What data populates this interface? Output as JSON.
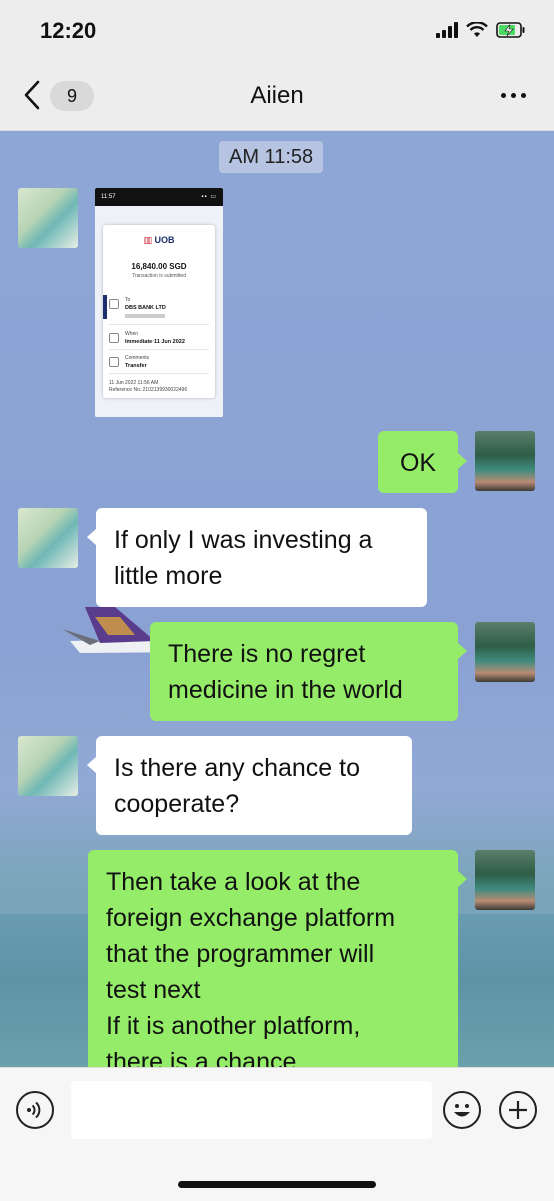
{
  "status_bar": {
    "time": "12:20"
  },
  "nav": {
    "badge": "9",
    "title": "Aiien"
  },
  "chat": {
    "timestamp": "AM 11:58",
    "receipt": {
      "phone_time": "11:57",
      "bank": "UOB",
      "amount": "16,840.00 SGD",
      "status": "Transaction is submitted",
      "to_label": "To",
      "to_value": "DBS BANK LTD",
      "when_label": "When",
      "when_value": "Immediate·11 Jun 2022",
      "comments_label": "Comments",
      "comments_value": "Transfer",
      "footer_time": "11 Jun 2022 11:56 AM",
      "reference": "Reference No.:21021399300224​96"
    },
    "messages": [
      {
        "from": "me",
        "lines": [
          "OK"
        ]
      },
      {
        "from": "contact",
        "lines": [
          "If only I was investing a",
          "little more"
        ]
      },
      {
        "from": "me",
        "lines": [
          "There is no regret",
          "medicine in the world"
        ]
      },
      {
        "from": "contact",
        "lines": [
          "Is there any chance to",
          "cooperate?"
        ]
      },
      {
        "from": "me",
        "lines": [
          "Then take a look at the",
          "foreign exchange platform",
          "that the programmer will",
          "test next",
          "If it is another platform,",
          "there is a chance"
        ]
      }
    ]
  },
  "input": {
    "placeholder": ""
  },
  "icons": [
    "chevron-left-icon",
    "more-icon",
    "voice-icon",
    "emoji-icon",
    "plus-icon",
    "signal-icon",
    "wifi-icon",
    "battery-icon"
  ],
  "colors": {
    "bubble_green": "#95ec69",
    "bubble_white": "#ffffff",
    "nav_bg": "#ededed"
  }
}
